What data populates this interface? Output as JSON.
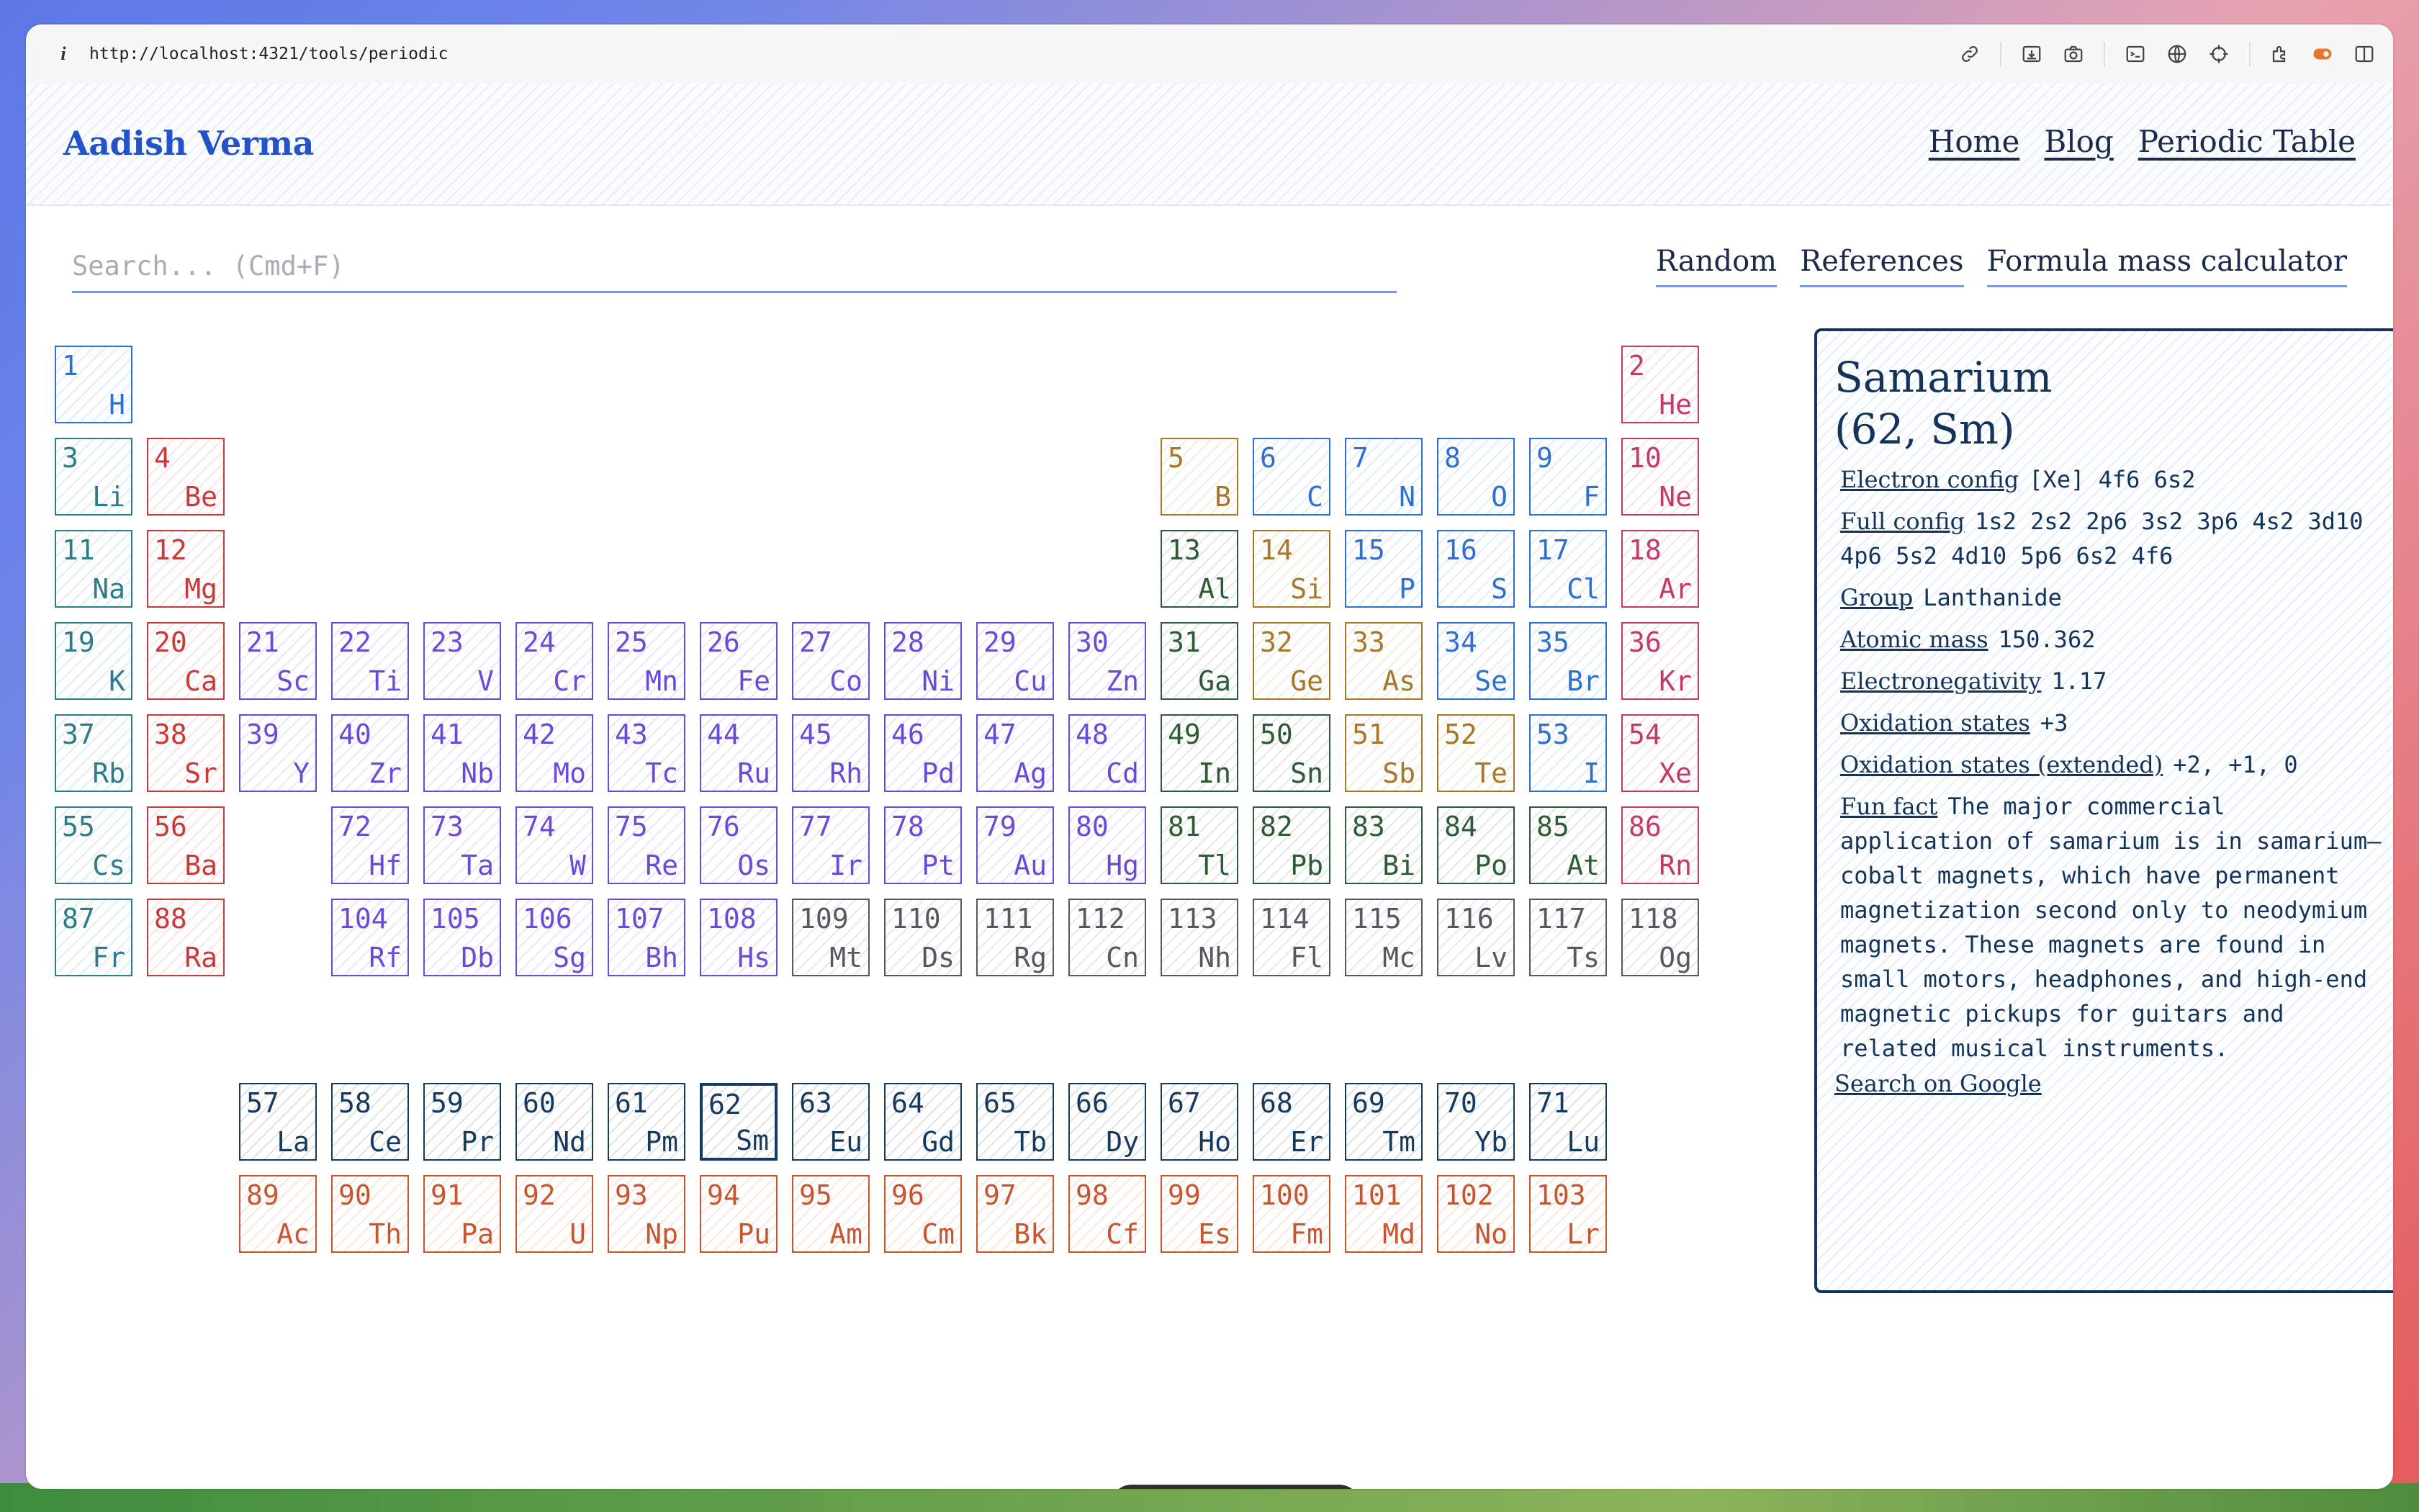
{
  "browser": {
    "info_icon": "i",
    "url": "http://localhost:4321/tools/periodic",
    "toolbar_icons": [
      "link-icon",
      "download-icon",
      "camera-icon",
      "terminal-icon",
      "globe-icon",
      "crosshair-icon",
      "extension-icon",
      "record-icon",
      "sidebar-icon"
    ]
  },
  "header": {
    "brand": "Aadish Verma",
    "nav": [
      "Home",
      "Blog",
      "Periodic Table"
    ]
  },
  "search": {
    "placeholder": "Search... (Cmd+F)",
    "value": ""
  },
  "links": [
    "Random",
    "References",
    "Formula mass calculator"
  ],
  "colors": {
    "nonmetal": "#2f6fcf",
    "noble": "#c43a66",
    "alkali": "#2e7c8a",
    "alkaline": "#c83a3a",
    "transition": "#6a4ad6",
    "metalloid": "#a8782a",
    "post_transition": "#2e5b36",
    "unknown": "#555a60",
    "lanthanide": "#163a5f",
    "actinide": "#c8552e"
  },
  "elements": [
    {
      "n": "1",
      "s": "H",
      "c": "nonmetal",
      "col": 1,
      "row": 1
    },
    {
      "n": "2",
      "s": "He",
      "c": "noble",
      "col": 18,
      "row": 1
    },
    {
      "n": "3",
      "s": "Li",
      "c": "alkali",
      "col": 1,
      "row": 2
    },
    {
      "n": "4",
      "s": "Be",
      "c": "alkaline",
      "col": 2,
      "row": 2
    },
    {
      "n": "5",
      "s": "B",
      "c": "metalloid",
      "col": 13,
      "row": 2
    },
    {
      "n": "6",
      "s": "C",
      "c": "nonmetal",
      "col": 14,
      "row": 2
    },
    {
      "n": "7",
      "s": "N",
      "c": "nonmetal",
      "col": 15,
      "row": 2
    },
    {
      "n": "8",
      "s": "O",
      "c": "nonmetal",
      "col": 16,
      "row": 2
    },
    {
      "n": "9",
      "s": "F",
      "c": "nonmetal",
      "col": 17,
      "row": 2
    },
    {
      "n": "10",
      "s": "Ne",
      "c": "noble",
      "col": 18,
      "row": 2
    },
    {
      "n": "11",
      "s": "Na",
      "c": "alkali",
      "col": 1,
      "row": 3
    },
    {
      "n": "12",
      "s": "Mg",
      "c": "alkaline",
      "col": 2,
      "row": 3
    },
    {
      "n": "13",
      "s": "Al",
      "c": "post_transition",
      "col": 13,
      "row": 3
    },
    {
      "n": "14",
      "s": "Si",
      "c": "metalloid",
      "col": 14,
      "row": 3
    },
    {
      "n": "15",
      "s": "P",
      "c": "nonmetal",
      "col": 15,
      "row": 3
    },
    {
      "n": "16",
      "s": "S",
      "c": "nonmetal",
      "col": 16,
      "row": 3
    },
    {
      "n": "17",
      "s": "Cl",
      "c": "nonmetal",
      "col": 17,
      "row": 3
    },
    {
      "n": "18",
      "s": "Ar",
      "c": "noble",
      "col": 18,
      "row": 3
    },
    {
      "n": "19",
      "s": "K",
      "c": "alkali",
      "col": 1,
      "row": 4
    },
    {
      "n": "20",
      "s": "Ca",
      "c": "alkaline",
      "col": 2,
      "row": 4
    },
    {
      "n": "21",
      "s": "Sc",
      "c": "transition",
      "col": 3,
      "row": 4
    },
    {
      "n": "22",
      "s": "Ti",
      "c": "transition",
      "col": 4,
      "row": 4
    },
    {
      "n": "23",
      "s": "V",
      "c": "transition",
      "col": 5,
      "row": 4
    },
    {
      "n": "24",
      "s": "Cr",
      "c": "transition",
      "col": 6,
      "row": 4
    },
    {
      "n": "25",
      "s": "Mn",
      "c": "transition",
      "col": 7,
      "row": 4
    },
    {
      "n": "26",
      "s": "Fe",
      "c": "transition",
      "col": 8,
      "row": 4
    },
    {
      "n": "27",
      "s": "Co",
      "c": "transition",
      "col": 9,
      "row": 4
    },
    {
      "n": "28",
      "s": "Ni",
      "c": "transition",
      "col": 10,
      "row": 4
    },
    {
      "n": "29",
      "s": "Cu",
      "c": "transition",
      "col": 11,
      "row": 4
    },
    {
      "n": "30",
      "s": "Zn",
      "c": "transition",
      "col": 12,
      "row": 4
    },
    {
      "n": "31",
      "s": "Ga",
      "c": "post_transition",
      "col": 13,
      "row": 4
    },
    {
      "n": "32",
      "s": "Ge",
      "c": "metalloid",
      "col": 14,
      "row": 4
    },
    {
      "n": "33",
      "s": "As",
      "c": "metalloid",
      "col": 15,
      "row": 4
    },
    {
      "n": "34",
      "s": "Se",
      "c": "nonmetal",
      "col": 16,
      "row": 4
    },
    {
      "n": "35",
      "s": "Br",
      "c": "nonmetal",
      "col": 17,
      "row": 4
    },
    {
      "n": "36",
      "s": "Kr",
      "c": "noble",
      "col": 18,
      "row": 4
    },
    {
      "n": "37",
      "s": "Rb",
      "c": "alkali",
      "col": 1,
      "row": 5
    },
    {
      "n": "38",
      "s": "Sr",
      "c": "alkaline",
      "col": 2,
      "row": 5
    },
    {
      "n": "39",
      "s": "Y",
      "c": "transition",
      "col": 3,
      "row": 5
    },
    {
      "n": "40",
      "s": "Zr",
      "c": "transition",
      "col": 4,
      "row": 5
    },
    {
      "n": "41",
      "s": "Nb",
      "c": "transition",
      "col": 5,
      "row": 5
    },
    {
      "n": "42",
      "s": "Mo",
      "c": "transition",
      "col": 6,
      "row": 5
    },
    {
      "n": "43",
      "s": "Tc",
      "c": "transition",
      "col": 7,
      "row": 5
    },
    {
      "n": "44",
      "s": "Ru",
      "c": "transition",
      "col": 8,
      "row": 5
    },
    {
      "n": "45",
      "s": "Rh",
      "c": "transition",
      "col": 9,
      "row": 5
    },
    {
      "n": "46",
      "s": "Pd",
      "c": "transition",
      "col": 10,
      "row": 5
    },
    {
      "n": "47",
      "s": "Ag",
      "c": "transition",
      "col": 11,
      "row": 5
    },
    {
      "n": "48",
      "s": "Cd",
      "c": "transition",
      "col": 12,
      "row": 5
    },
    {
      "n": "49",
      "s": "In",
      "c": "post_transition",
      "col": 13,
      "row": 5
    },
    {
      "n": "50",
      "s": "Sn",
      "c": "post_transition",
      "col": 14,
      "row": 5
    },
    {
      "n": "51",
      "s": "Sb",
      "c": "metalloid",
      "col": 15,
      "row": 5
    },
    {
      "n": "52",
      "s": "Te",
      "c": "metalloid",
      "col": 16,
      "row": 5
    },
    {
      "n": "53",
      "s": "I",
      "c": "nonmetal",
      "col": 17,
      "row": 5
    },
    {
      "n": "54",
      "s": "Xe",
      "c": "noble",
      "col": 18,
      "row": 5
    },
    {
      "n": "55",
      "s": "Cs",
      "c": "alkali",
      "col": 1,
      "row": 6
    },
    {
      "n": "56",
      "s": "Ba",
      "c": "alkaline",
      "col": 2,
      "row": 6
    },
    {
      "n": "72",
      "s": "Hf",
      "c": "transition",
      "col": 4,
      "row": 6
    },
    {
      "n": "73",
      "s": "Ta",
      "c": "transition",
      "col": 5,
      "row": 6
    },
    {
      "n": "74",
      "s": "W",
      "c": "transition",
      "col": 6,
      "row": 6
    },
    {
      "n": "75",
      "s": "Re",
      "c": "transition",
      "col": 7,
      "row": 6
    },
    {
      "n": "76",
      "s": "Os",
      "c": "transition",
      "col": 8,
      "row": 6
    },
    {
      "n": "77",
      "s": "Ir",
      "c": "transition",
      "col": 9,
      "row": 6
    },
    {
      "n": "78",
      "s": "Pt",
      "c": "transition",
      "col": 10,
      "row": 6
    },
    {
      "n": "79",
      "s": "Au",
      "c": "transition",
      "col": 11,
      "row": 6
    },
    {
      "n": "80",
      "s": "Hg",
      "c": "transition",
      "col": 12,
      "row": 6
    },
    {
      "n": "81",
      "s": "Tl",
      "c": "post_transition",
      "col": 13,
      "row": 6
    },
    {
      "n": "82",
      "s": "Pb",
      "c": "post_transition",
      "col": 14,
      "row": 6
    },
    {
      "n": "83",
      "s": "Bi",
      "c": "post_transition",
      "col": 15,
      "row": 6
    },
    {
      "n": "84",
      "s": "Po",
      "c": "post_transition",
      "col": 16,
      "row": 6
    },
    {
      "n": "85",
      "s": "At",
      "c": "post_transition",
      "col": 17,
      "row": 6
    },
    {
      "n": "86",
      "s": "Rn",
      "c": "noble",
      "col": 18,
      "row": 6
    },
    {
      "n": "87",
      "s": "Fr",
      "c": "alkali",
      "col": 1,
      "row": 7
    },
    {
      "n": "88",
      "s": "Ra",
      "c": "alkaline",
      "col": 2,
      "row": 7
    },
    {
      "n": "104",
      "s": "Rf",
      "c": "transition",
      "col": 4,
      "row": 7
    },
    {
      "n": "105",
      "s": "Db",
      "c": "transition",
      "col": 5,
      "row": 7
    },
    {
      "n": "106",
      "s": "Sg",
      "c": "transition",
      "col": 6,
      "row": 7
    },
    {
      "n": "107",
      "s": "Bh",
      "c": "transition",
      "col": 7,
      "row": 7
    },
    {
      "n": "108",
      "s": "Hs",
      "c": "transition",
      "col": 8,
      "row": 7
    },
    {
      "n": "109",
      "s": "Mt",
      "c": "unknown",
      "col": 9,
      "row": 7
    },
    {
      "n": "110",
      "s": "Ds",
      "c": "unknown",
      "col": 10,
      "row": 7
    },
    {
      "n": "111",
      "s": "Rg",
      "c": "unknown",
      "col": 11,
      "row": 7
    },
    {
      "n": "112",
      "s": "Cn",
      "c": "unknown",
      "col": 12,
      "row": 7
    },
    {
      "n": "113",
      "s": "Nh",
      "c": "unknown",
      "col": 13,
      "row": 7
    },
    {
      "n": "114",
      "s": "Fl",
      "c": "unknown",
      "col": 14,
      "row": 7
    },
    {
      "n": "115",
      "s": "Mc",
      "c": "unknown",
      "col": 15,
      "row": 7
    },
    {
      "n": "116",
      "s": "Lv",
      "c": "unknown",
      "col": 16,
      "row": 7
    },
    {
      "n": "117",
      "s": "Ts",
      "c": "unknown",
      "col": 17,
      "row": 7
    },
    {
      "n": "118",
      "s": "Og",
      "c": "unknown",
      "col": 18,
      "row": 7
    },
    {
      "n": "57",
      "s": "La",
      "c": "lanthanide",
      "col": 3,
      "row": 9
    },
    {
      "n": "58",
      "s": "Ce",
      "c": "lanthanide",
      "col": 4,
      "row": 9
    },
    {
      "n": "59",
      "s": "Pr",
      "c": "lanthanide",
      "col": 5,
      "row": 9
    },
    {
      "n": "60",
      "s": "Nd",
      "c": "lanthanide",
      "col": 6,
      "row": 9
    },
    {
      "n": "61",
      "s": "Pm",
      "c": "lanthanide",
      "col": 7,
      "row": 9
    },
    {
      "n": "62",
      "s": "Sm",
      "c": "lanthanide",
      "col": 8,
      "row": 9,
      "active": true
    },
    {
      "n": "63",
      "s": "Eu",
      "c": "lanthanide",
      "col": 9,
      "row": 9
    },
    {
      "n": "64",
      "s": "Gd",
      "c": "lanthanide",
      "col": 10,
      "row": 9
    },
    {
      "n": "65",
      "s": "Tb",
      "c": "lanthanide",
      "col": 11,
      "row": 9
    },
    {
      "n": "66",
      "s": "Dy",
      "c": "lanthanide",
      "col": 12,
      "row": 9
    },
    {
      "n": "67",
      "s": "Ho",
      "c": "lanthanide",
      "col": 13,
      "row": 9
    },
    {
      "n": "68",
      "s": "Er",
      "c": "lanthanide",
      "col": 14,
      "row": 9
    },
    {
      "n": "69",
      "s": "Tm",
      "c": "lanthanide",
      "col": 15,
      "row": 9
    },
    {
      "n": "70",
      "s": "Yb",
      "c": "lanthanide",
      "col": 16,
      "row": 9
    },
    {
      "n": "71",
      "s": "Lu",
      "c": "lanthanide",
      "col": 17,
      "row": 9
    },
    {
      "n": "89",
      "s": "Ac",
      "c": "actinide",
      "col": 3,
      "row": 10
    },
    {
      "n": "90",
      "s": "Th",
      "c": "actinide",
      "col": 4,
      "row": 10
    },
    {
      "n": "91",
      "s": "Pa",
      "c": "actinide",
      "col": 5,
      "row": 10
    },
    {
      "n": "92",
      "s": "U",
      "c": "actinide",
      "col": 6,
      "row": 10
    },
    {
      "n": "93",
      "s": "Np",
      "c": "actinide",
      "col": 7,
      "row": 10
    },
    {
      "n": "94",
      "s": "Pu",
      "c": "actinide",
      "col": 8,
      "row": 10
    },
    {
      "n": "95",
      "s": "Am",
      "c": "actinide",
      "col": 9,
      "row": 10
    },
    {
      "n": "96",
      "s": "Cm",
      "c": "actinide",
      "col": 10,
      "row": 10
    },
    {
      "n": "97",
      "s": "Bk",
      "c": "actinide",
      "col": 11,
      "row": 10
    },
    {
      "n": "98",
      "s": "Cf",
      "c": "actinide",
      "col": 12,
      "row": 10
    },
    {
      "n": "99",
      "s": "Es",
      "c": "actinide",
      "col": 13,
      "row": 10
    },
    {
      "n": "100",
      "s": "Fm",
      "c": "actinide",
      "col": 14,
      "row": 10
    },
    {
      "n": "101",
      "s": "Md",
      "c": "actinide",
      "col": 15,
      "row": 10
    },
    {
      "n": "102",
      "s": "No",
      "c": "actinide",
      "col": 16,
      "row": 10
    },
    {
      "n": "103",
      "s": "Lr",
      "c": "actinide",
      "col": 17,
      "row": 10
    }
  ],
  "detail": {
    "title_line1": "Samarium",
    "title_line2": "(62, Sm)",
    "electron_config_label": "Electron config",
    "electron_config": "[Xe] 4f6 6s2",
    "full_config_label": "Full config",
    "full_config": "1s2 2s2 2p6 3s2 3p6 4s2 3d10 4p6 5s2 4d10 5p6 6s2 4f6",
    "group_label": "Group",
    "group": "Lanthanide",
    "atomic_mass_label": "Atomic mass",
    "atomic_mass": "150.362",
    "electronegativity_label": "Electronegativity",
    "electronegativity": "1.17",
    "oxidation_label": "Oxidation states",
    "oxidation": "+3",
    "oxidation_ext_label": "Oxidation states (extended)",
    "oxidation_ext": "+2, +1, 0",
    "fun_fact_label": "Fun fact",
    "fun_fact": "The major commercial application of samarium is in samarium–cobalt magnets, which have permanent magnetization second only to neodymium magnets. These magnets are found in small motors, headphones, and high-end magnetic pickups for guitars and related musical instruments.",
    "google": "Search on Google"
  }
}
